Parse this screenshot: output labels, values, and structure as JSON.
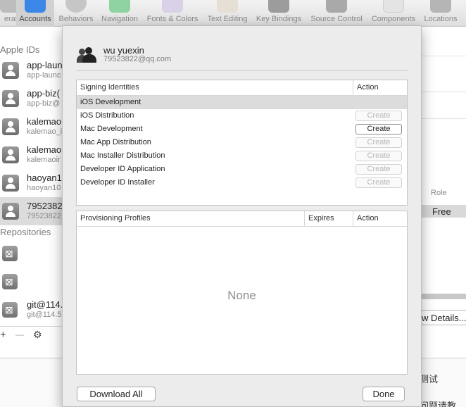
{
  "toolbar": {
    "items": [
      {
        "label": "eral",
        "icon": "general-icon"
      },
      {
        "label": "Accounts",
        "icon": "at-sign-icon",
        "selected": true
      },
      {
        "label": "Behaviors",
        "icon": "gear-icon"
      },
      {
        "label": "Navigation",
        "icon": "navigation-icon"
      },
      {
        "label": "Fonts & Colors",
        "icon": "fonts-colors-icon"
      },
      {
        "label": "Text Editing",
        "icon": "text-editing-icon"
      },
      {
        "label": "Key Bindings",
        "icon": "key-bindings-icon"
      },
      {
        "label": "Source Control",
        "icon": "source-control-icon"
      },
      {
        "label": "Components",
        "icon": "components-icon"
      },
      {
        "label": "Locations",
        "icon": "locations-icon"
      }
    ],
    "accent_color": "#3b87e8"
  },
  "left": {
    "apple_ids_header": "Apple IDs",
    "accounts": [
      {
        "title": "app-laun",
        "subtitle": "app-launc"
      },
      {
        "title": "app-biz(",
        "subtitle": "app-biz@"
      },
      {
        "title": "kalemao",
        "subtitle": "kalemao_i"
      },
      {
        "title": "kalemao",
        "subtitle": "kalemaoir"
      },
      {
        "title": "haoyan1(",
        "subtitle": "haoyan10"
      },
      {
        "title": "7952382",
        "subtitle": "79523822"
      }
    ],
    "repositories_header": "Repositories",
    "repositories": [
      {
        "title": "",
        "subtitle": ""
      },
      {
        "title": "",
        "subtitle": ""
      },
      {
        "title": "git@114.",
        "subtitle": "git@114.5"
      }
    ],
    "footer": {
      "add": "+",
      "remove": "—",
      "settings": "⚙"
    }
  },
  "right": {
    "role_header": "Role",
    "role_value": "Free",
    "view_details": "w Details...",
    "bottom_text_1": "测试",
    "bottom_text_2": "问题请教"
  },
  "sheet": {
    "user_name": "wu yuexin",
    "user_email": "79523822@qq.com",
    "signing": {
      "col_identity": "Signing Identities",
      "col_action": "Action",
      "rows": [
        {
          "name": "iOS Development",
          "button": ""
        },
        {
          "name": "iOS Distribution",
          "button": "Create"
        },
        {
          "name": "Mac Development",
          "button": "Create"
        },
        {
          "name": "Mac App Distribution",
          "button": "Create"
        },
        {
          "name": "Mac Installer Distribution",
          "button": "Create"
        },
        {
          "name": "Developer ID Application",
          "button": "Create"
        },
        {
          "name": "Developer ID Installer",
          "button": "Create"
        }
      ]
    },
    "profiles": {
      "col_profile": "Provisioning Profiles",
      "col_expires": "Expires",
      "col_action": "Action",
      "empty_text": "None"
    },
    "download_all": "Download All",
    "done": "Done"
  }
}
